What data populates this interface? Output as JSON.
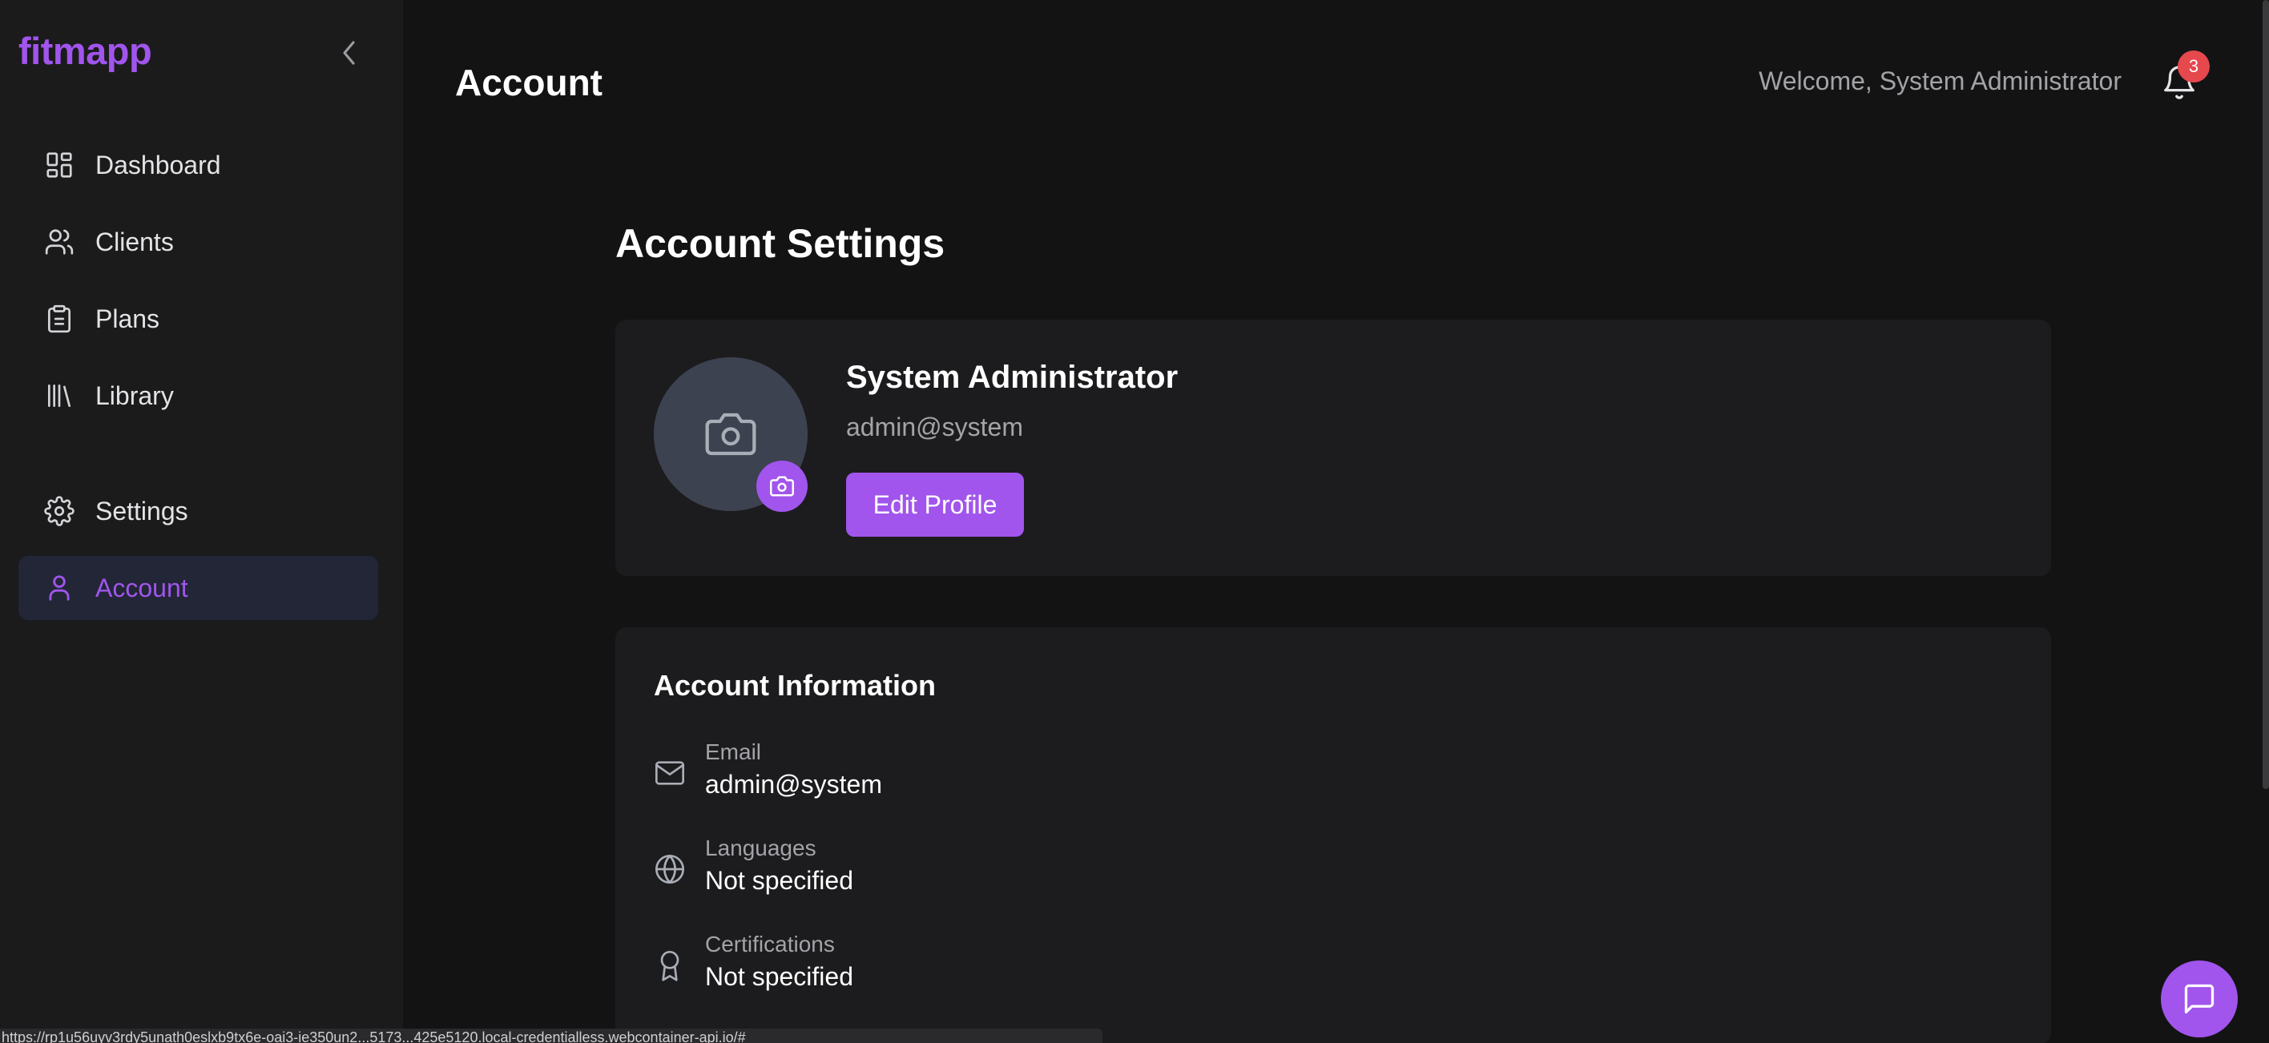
{
  "sidebar": {
    "logo": "fitmapp",
    "items": [
      {
        "label": "Dashboard",
        "icon": "dashboard-icon"
      },
      {
        "label": "Clients",
        "icon": "users-icon"
      },
      {
        "label": "Plans",
        "icon": "clipboard-icon"
      },
      {
        "label": "Library",
        "icon": "library-icon"
      },
      {
        "label": "Settings",
        "icon": "gear-icon"
      },
      {
        "label": "Account",
        "icon": "user-icon",
        "active": true
      }
    ]
  },
  "header": {
    "title": "Account",
    "welcome": "Welcome, System Administrator",
    "notification_count": "3"
  },
  "main": {
    "section_title": "Account Settings",
    "profile": {
      "name": "System Administrator",
      "email": "admin@system",
      "edit_label": "Edit Profile"
    },
    "info": {
      "title": "Account Information",
      "rows": [
        {
          "label": "Email",
          "value": "admin@system",
          "icon": "mail-icon"
        },
        {
          "label": "Languages",
          "value": "Not specified",
          "icon": "globe-icon"
        },
        {
          "label": "Certifications",
          "value": "Not specified",
          "icon": "award-icon"
        }
      ]
    }
  },
  "status_bar": {
    "url": "https://rp1u56uyv3rdy5unath0eslxb9tx6e-oai3-ie350un2...5173...425e5120.local-credentialless.webcontainer-api.io/#"
  },
  "colors": {
    "accent": "#a155ec",
    "sidebar_bg": "#1b1b1c",
    "page_bg": "#131314",
    "card_bg": "#1c1c1e",
    "active_item_bg": "#222636",
    "badge": "#e5484d"
  }
}
